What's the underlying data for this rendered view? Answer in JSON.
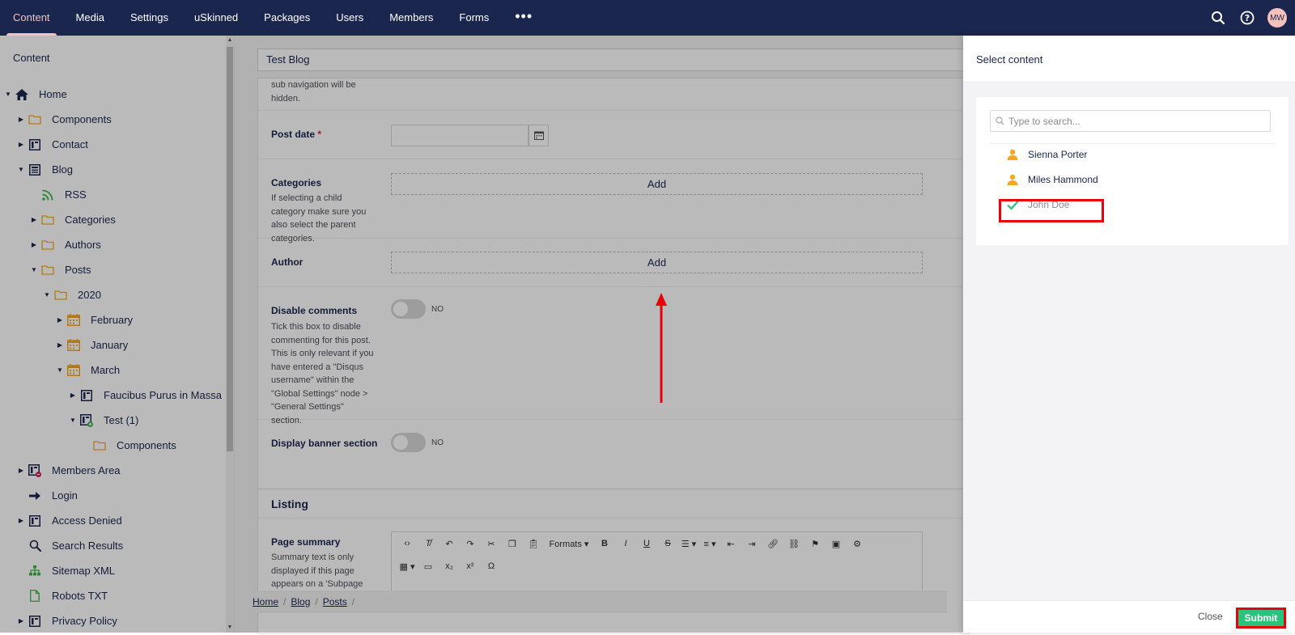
{
  "topbar": {
    "sections": [
      "Content",
      "Media",
      "Settings",
      "uSkinned",
      "Packages",
      "Users",
      "Members",
      "Forms"
    ],
    "active": "Content",
    "more": "•••",
    "user_initials": "MW",
    "icons": [
      "search-icon",
      "help-icon"
    ]
  },
  "sidebar": {
    "title": "Content",
    "tree": [
      {
        "label": "Home",
        "icon": "home-icon",
        "expanded": true
      },
      {
        "label": "Components",
        "icon": "folder-icon"
      },
      {
        "label": "Contact",
        "icon": "page-icon"
      },
      {
        "label": "Blog",
        "icon": "blog-icon",
        "expanded": true
      },
      {
        "label": "RSS",
        "icon": "rss-icon"
      },
      {
        "label": "Categories",
        "icon": "folder-icon"
      },
      {
        "label": "Authors",
        "icon": "folder-icon"
      },
      {
        "label": "Posts",
        "icon": "folder-icon",
        "expanded": true
      },
      {
        "label": "2020",
        "icon": "folder-icon",
        "expanded": true
      },
      {
        "label": "February",
        "icon": "calendar-icon"
      },
      {
        "label": "January",
        "icon": "calendar-icon"
      },
      {
        "label": "March",
        "icon": "calendar-icon",
        "expanded": true
      },
      {
        "label": "Faucibus Purus in Massa",
        "icon": "page-icon"
      },
      {
        "label": "Test (1)",
        "icon": "page-new-icon",
        "expanded": true
      },
      {
        "label": "Components",
        "icon": "folder-icon"
      },
      {
        "label": "Members Area",
        "icon": "page-protected-icon"
      },
      {
        "label": "Login",
        "icon": "arrow-right-icon"
      },
      {
        "label": "Access Denied",
        "icon": "page-icon"
      },
      {
        "label": "Search Results",
        "icon": "search-icon"
      },
      {
        "label": "Sitemap XML",
        "icon": "sitemap-icon"
      },
      {
        "label": "Robots TXT",
        "icon": "file-icon"
      },
      {
        "label": "Privacy Policy",
        "icon": "page-icon"
      }
    ]
  },
  "editor": {
    "doc_name": "Test Blog",
    "truncated_desc": "sub navigation will be hidden.",
    "post_date": {
      "label": "Post date",
      "required": "*"
    },
    "categories": {
      "label": "Categories",
      "desc": "If selecting a child category make sure you also select the parent categories.",
      "add": "Add"
    },
    "author": {
      "label": "Author",
      "add": "Add"
    },
    "disable_comments": {
      "label": "Disable comments",
      "desc": "Tick this box to disable commenting for this post. This is only relevant if you have entered a \"Disqus username\" within the \"Global Settings\" node > \"General Settings\" section.",
      "toggle": "NO"
    },
    "display_banner": {
      "label": "Display banner section",
      "toggle": "NO"
    },
    "listing": {
      "heading": "Listing"
    },
    "page_summary": {
      "label": "Page summary",
      "desc": "Summary text is only displayed if this page appears on a 'Subpage",
      "formats": "Formats"
    },
    "breadcrumb": [
      "Home",
      "Blog",
      "Posts"
    ]
  },
  "select_panel": {
    "title": "Select content",
    "search_placeholder": "Type to search...",
    "items": [
      {
        "label": "Sienna Porter",
        "icon": "user-icon",
        "selected": false
      },
      {
        "label": "Miles Hammond",
        "icon": "user-icon",
        "selected": false
      },
      {
        "label": "John Doe",
        "icon": "checkmark-icon",
        "selected": true
      }
    ],
    "close": "Close",
    "submit": "Submit"
  },
  "colors": {
    "topbar": "#1b264f",
    "active_nav": "#f5c1bc",
    "submit": "#2bc37c",
    "annotation": "#e8000b",
    "folder": "#f5a623"
  }
}
